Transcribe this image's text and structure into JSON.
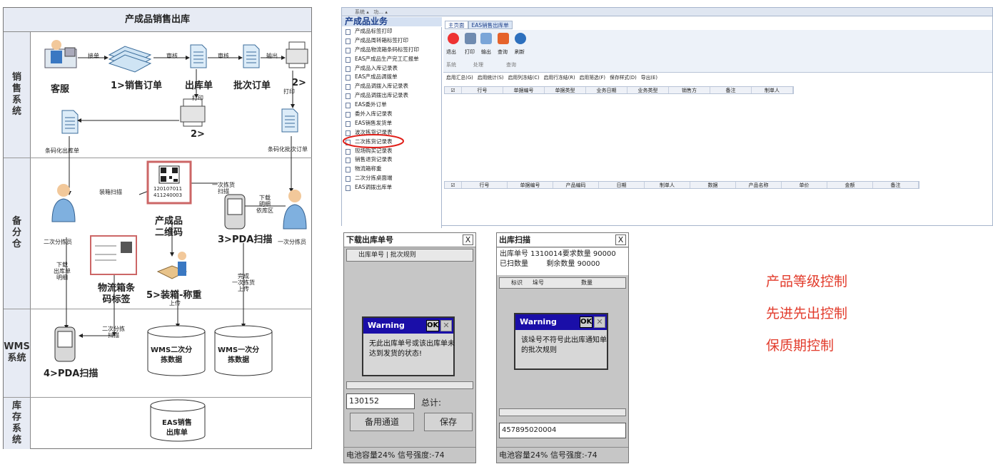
{
  "flow": {
    "title": "产成品销售出库",
    "lanes": [
      "销售系统",
      "备分仓",
      "WMS系统",
      "库存系统"
    ],
    "nodes": {
      "kefu": "客服",
      "order": "1>销售订单",
      "outlist": "出库单",
      "batch": "批次订单",
      "two_a": "2>",
      "two_b": "2>",
      "barcode_out": "条码化出库单",
      "barcode_batch": "条码化批次订单",
      "picker2": "二次分拣员",
      "picker1": "一次分拣员",
      "qr_title": "产成品\n二维码",
      "qr_digits": "120107011\n411240003",
      "pda3": "3>PDA扫描",
      "box_label": "物流箱条\n码标签",
      "pack": "5>装箱-称重",
      "pda4": "4>PDA扫描",
      "db_wms2": "WMS二次分\n拣数据",
      "db_wms1": "WMS一次分\n拣数据",
      "db_eas": "EAS销售\n出库单"
    },
    "edges": {
      "jiedan": "接单",
      "shenhe1": "审核",
      "shenhe2": "审核",
      "shuchu": "输出",
      "dayin1": "打印",
      "dayin2": "打印",
      "zhuangxiang": "装箱扫描",
      "yicijianhuo": "一次拣货\n扫描",
      "xiazai": "下载\n明细\n依库区",
      "xiazaichuku": "下载\n出库单\n明细",
      "wancheng": "完成\n一次拣货\n上传",
      "shangchuan": "上传",
      "ercifenjian": "二次分拣\n扫描"
    }
  },
  "app": {
    "top_tabs": [
      "系统",
      "功..."
    ],
    "tree_title": "产成品业务",
    "tree_items": [
      "产成品标签打印",
      "产成品周转箱标签打印",
      "产成品物流箱条码标签打印",
      "EAS产成品生产完工汇报单",
      "产成品入库记录表",
      "EAS产成品调拨单",
      "产成品调拨入库记录表",
      "产成品调拨出库记录表",
      "EAS委外订单",
      "委外入库记录表",
      "EAS销售发货单",
      "波次拣货记录表",
      "二次拣货记录表",
      "现场购买记录表",
      "销售退货记录表",
      "物流箱称重",
      "二次分拣桌面端",
      "EAS调拨出库单"
    ],
    "tabs": [
      "主页面",
      "EAS销售出库单"
    ],
    "ribbon_buttons": [
      "退出",
      "打印",
      "输出",
      "查询",
      "刷新"
    ],
    "ribbon_groups": [
      "系统",
      "处理",
      "查询"
    ],
    "toolbar": [
      "启用汇总(G)",
      "启用统计(S)",
      "启用列冻结(C)",
      "启用行冻结(R)",
      "启用筛选(F)",
      "保存样式(D)",
      "导出(E)"
    ],
    "grid1_cols": [
      "行号",
      "单据编号",
      "单据类型",
      "业务日期",
      "业务类型",
      "销售方",
      "备注",
      "制单人"
    ],
    "grid2_cols": [
      "行号",
      "单据编号",
      "产品编码",
      "日期",
      "制单人",
      "数据",
      "产品名称",
      "单价",
      "金额",
      "备注"
    ]
  },
  "pda1": {
    "title": "下载出库单号",
    "close": "X",
    "cols": [
      "出库单号",
      "批次规则"
    ],
    "warning_title": "Warning",
    "ok": "OK",
    "warning_text": "无此出库单号或该出库单未\n达到发货的状态!",
    "input_value": "130152",
    "total_label": "总计:",
    "btn_backup": "备用通道",
    "btn_save": "保存",
    "status": "电池容量24%   信号强度:-74"
  },
  "pda2": {
    "title": "出库扫描",
    "close": "X",
    "line1": "出库单号 1310014要求数量 90000",
    "line2": "已扫数量        剩余数量 90000",
    "cols": [
      "标识",
      "垛号",
      "数量"
    ],
    "warning_title": "Warning",
    "ok": "OK",
    "warning_text": "该垛号不符号此出库通知单\n的批次规则",
    "input_value": "457895020004",
    "status": "电池容量24%   信号强度:-74"
  },
  "controls": [
    "产品等级控制",
    "先进先出控制",
    "保质期控制"
  ],
  "colors": {
    "red_text": "#e23b2b",
    "warning_bar": "#1a0ea8",
    "lane_bg": "#e7ebf4",
    "tree_title": "#1c3f8a"
  }
}
